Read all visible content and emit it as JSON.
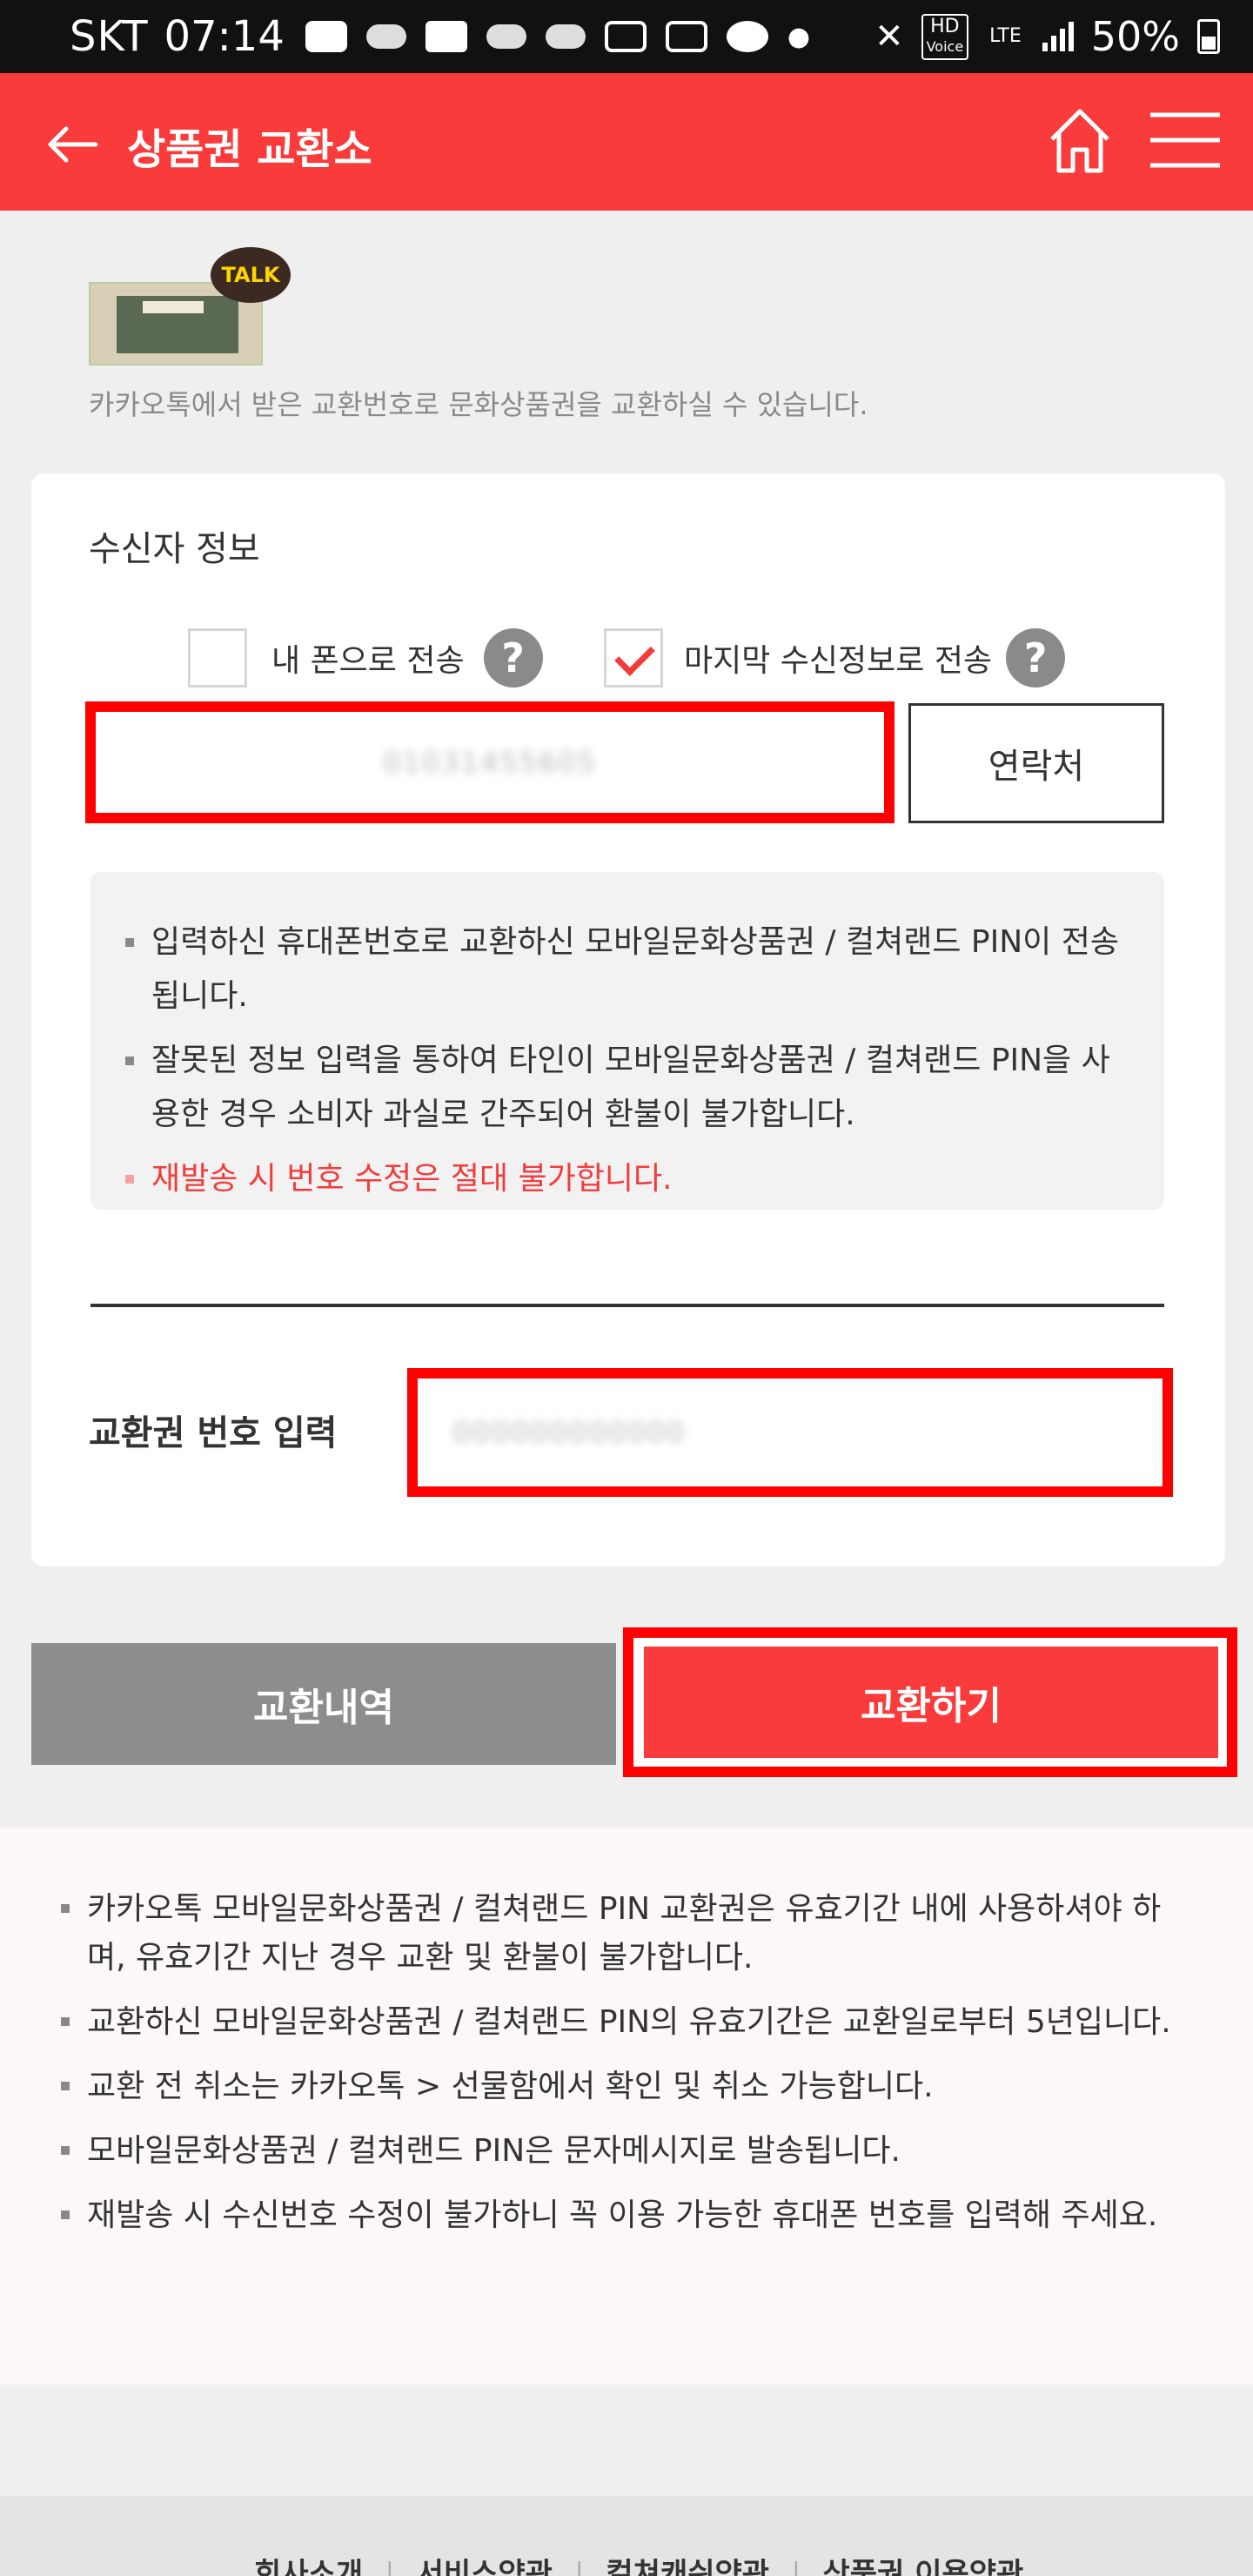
{
  "status_bar": {
    "carrier": "SKT",
    "time": "07:14",
    "hd_label": "HD",
    "voice_label": "Voice",
    "lte_label": "LTE",
    "battery": "50%"
  },
  "header": {
    "title": "상품권 교환소"
  },
  "intro": {
    "badge": "TALK",
    "text": "카카오톡에서 받은 교환번호로 문화상품권을 교환하실 수 있습니다."
  },
  "recipient": {
    "title": "수신자 정보",
    "option_my_phone": "내 폰으로 전송",
    "option_last_info": "마지막 수신정보로 전송",
    "phone_value": "01031455605",
    "contact_button": "연락처"
  },
  "notices": [
    "입력하신 휴대폰번호로 교환하신 모바일문화상품권 / 컬쳐랜드 PIN이 전송됩니다.",
    "잘못된 정보 입력을 통하여 타인이 모바일문화상품권 / 컬쳐랜드 PIN을 사용한 경우 소비자 과실로 간주되어 환불이 불가합니다.",
    "재발송 시 번호 수정은 절대 불가합니다."
  ],
  "voucher": {
    "label": "교환권 번호 입력",
    "value": "000000000000"
  },
  "actions": {
    "history": "교환내역",
    "exchange": "교환하기"
  },
  "info": [
    "카카오톡 모바일문화상품권 / 컬쳐랜드 PIN 교환권은 유효기간 내에 사용하셔야 하며, 유효기간 지난 경우 교환 및 환불이 불가합니다.",
    "교환하신 모바일문화상품권 / 컬쳐랜드 PIN의 유효기간은 교환일로부터 5년입니다.",
    "교환 전 취소는 카카오톡 > 선물함에서 확인 및 취소 가능합니다.",
    "모바일문화상품권 / 컬쳐랜드 PIN은 문자메시지로 발송됩니다.",
    "재발송 시 수신번호 수정이 불가하니 꼭 이용 가능한 휴대폰 번호를 입력해 주세요."
  ],
  "footer": {
    "links": [
      "회사소개",
      "서비스약관",
      "컬쳐캐쉬약관",
      "상품권 이용약관"
    ]
  },
  "colors": {
    "brand_red": "#f93b3b",
    "highlight_red": "#ff0000",
    "gray_button": "#8d8d8d"
  }
}
